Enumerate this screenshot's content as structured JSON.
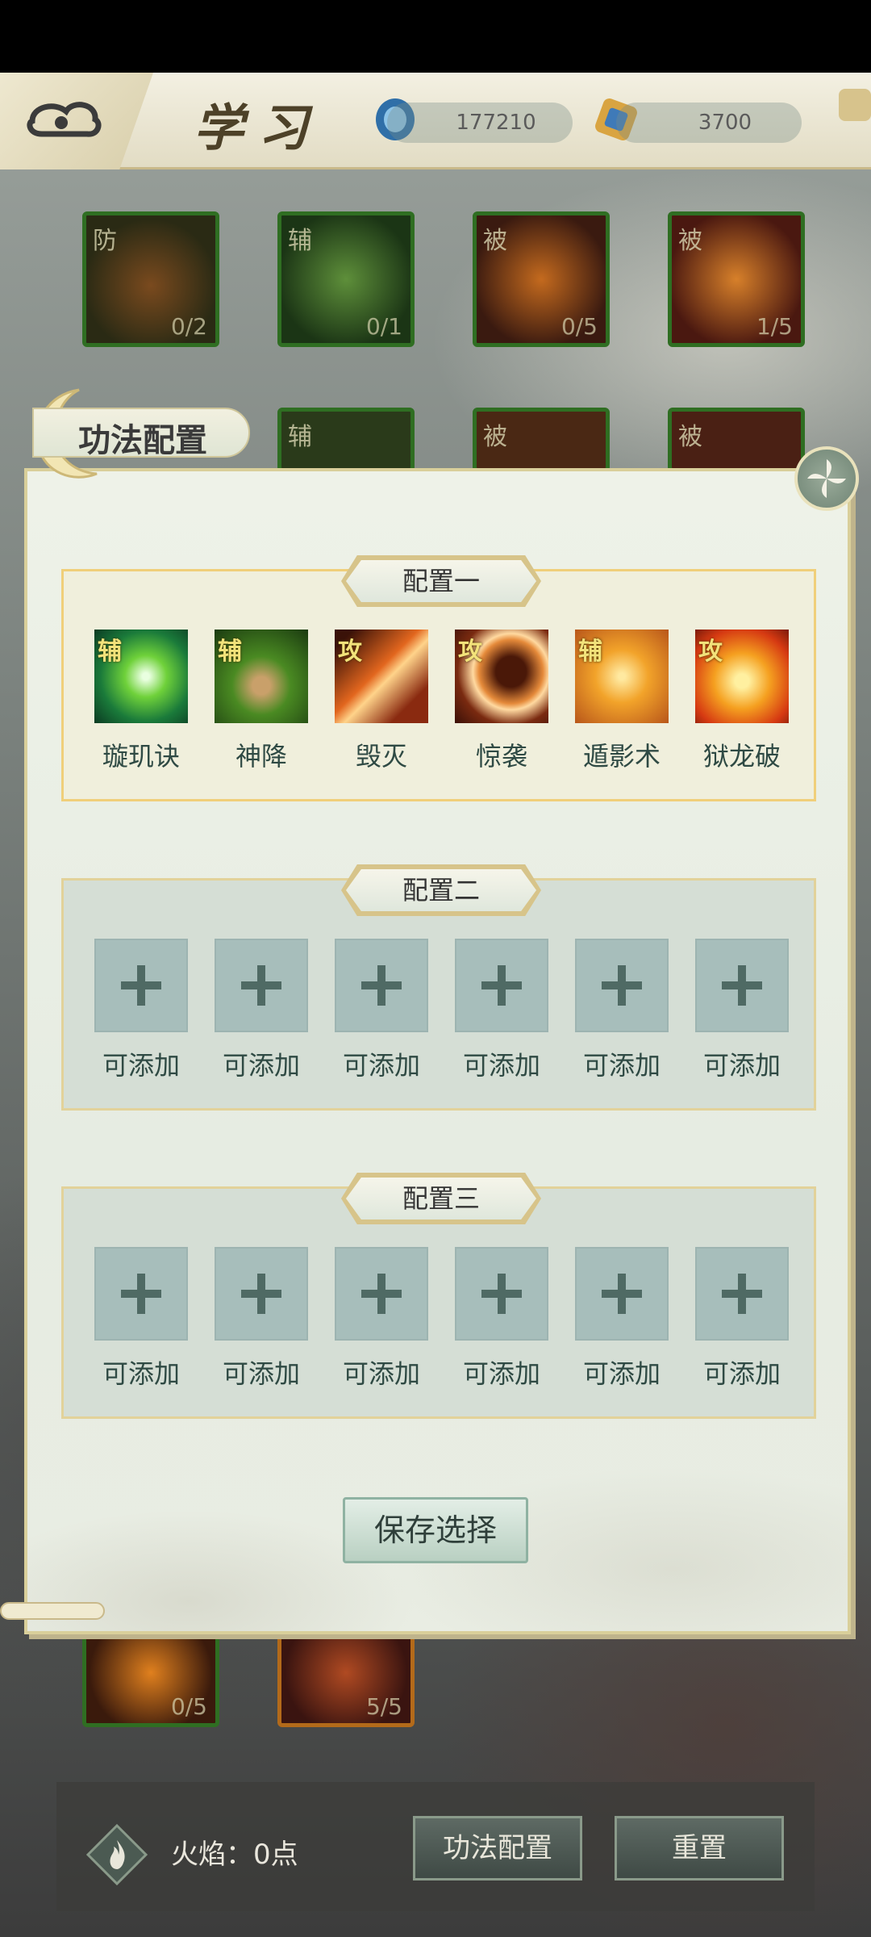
{
  "header": {
    "title": "学习",
    "currency1_value": "177210",
    "currency2_value": "3700"
  },
  "background_skills": [
    {
      "tag": "防",
      "count": "0/2"
    },
    {
      "tag": "辅",
      "count": "0/1"
    },
    {
      "tag": "被",
      "count": "0/5"
    },
    {
      "tag": "被",
      "count": "1/5"
    },
    {
      "tag": "辅",
      "count": ""
    },
    {
      "tag": "被",
      "count": ""
    },
    {
      "tag": "被",
      "count": ""
    },
    {
      "tag": "",
      "count": "0/5"
    },
    {
      "tag": "",
      "count": "5/5"
    }
  ],
  "dialog": {
    "title": "功法配置",
    "save_label": "保存选择",
    "configs": [
      {
        "title": "配置一",
        "slots": [
          {
            "tag": "辅",
            "name": "璇玑诀",
            "icon": "green-swirl-icon"
          },
          {
            "tag": "辅",
            "name": "神降",
            "icon": "meditating-monk-icon"
          },
          {
            "tag": "攻",
            "name": "毁灭",
            "icon": "fire-slash-icon"
          },
          {
            "tag": "攻",
            "name": "惊袭",
            "icon": "crescent-strike-icon"
          },
          {
            "tag": "辅",
            "name": "遁影术",
            "icon": "boot-icon"
          },
          {
            "tag": "攻",
            "name": "狱龙破",
            "icon": "dragon-fire-icon"
          }
        ]
      },
      {
        "title": "配置二",
        "slots": [
          {
            "name": "可添加"
          },
          {
            "name": "可添加"
          },
          {
            "name": "可添加"
          },
          {
            "name": "可添加"
          },
          {
            "name": "可添加"
          },
          {
            "name": "可添加"
          }
        ]
      },
      {
        "title": "配置三",
        "slots": [
          {
            "name": "可添加"
          },
          {
            "name": "可添加"
          },
          {
            "name": "可添加"
          },
          {
            "name": "可添加"
          },
          {
            "name": "可添加"
          },
          {
            "name": "可添加"
          }
        ]
      }
    ]
  },
  "footer": {
    "flame_text": "火焰：0点",
    "config_button": "功法配置",
    "reset_button": "重置"
  }
}
